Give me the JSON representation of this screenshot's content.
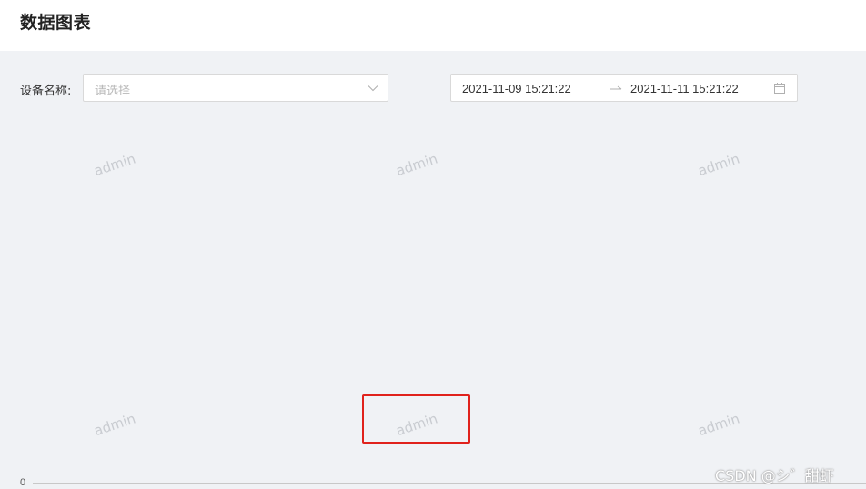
{
  "header": {
    "title": "数据图表"
  },
  "filters": {
    "device_label": "设备名称:",
    "device_placeholder": "请选择",
    "date_start": "2021-11-09 15:21:22",
    "date_end": "2021-11-11 15:21:22"
  },
  "icons": {
    "select_chevron": "chevron-down-icon",
    "range_separator": "arrow-right-icon",
    "calendar": "calendar-icon"
  },
  "watermark": {
    "text": "admin"
  },
  "chart": {
    "axis_zero_label": "0"
  },
  "footer": {
    "credit": "CSDN @シ゛甜虾"
  },
  "colors": {
    "background": "#f0f2f5",
    "highlight": "#e0221c"
  }
}
